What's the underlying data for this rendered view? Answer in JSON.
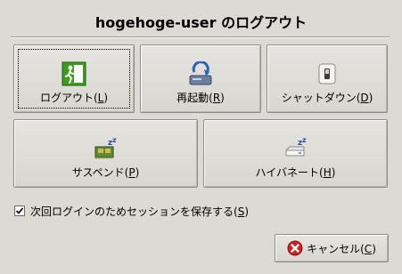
{
  "dialog": {
    "title": "hogehoge-user のログアウト"
  },
  "buttons": {
    "logout": {
      "label": "ログアウト(",
      "mnemonic": "L",
      "label_end": ")"
    },
    "restart": {
      "label": "再起動(",
      "mnemonic": "R",
      "label_end": ")"
    },
    "shutdown": {
      "label": "シャットダウン(",
      "mnemonic": "D",
      "label_end": ")"
    },
    "suspend": {
      "label": "サスペンド(",
      "mnemonic": "P",
      "label_end": ")"
    },
    "hibernate": {
      "label": "ハイバネート(",
      "mnemonic": "H",
      "label_end": ")"
    },
    "cancel": {
      "label": "キャンセル(",
      "mnemonic": "C",
      "label_end": ")"
    }
  },
  "save_session": {
    "label": "次回ログインのためセッションを保存する(",
    "mnemonic": "S",
    "label_end": ")",
    "checked": true
  },
  "colors": {
    "background": "#dcdad5",
    "exit_green": "#3f9a1f",
    "cancel_red": "#cc2222"
  }
}
